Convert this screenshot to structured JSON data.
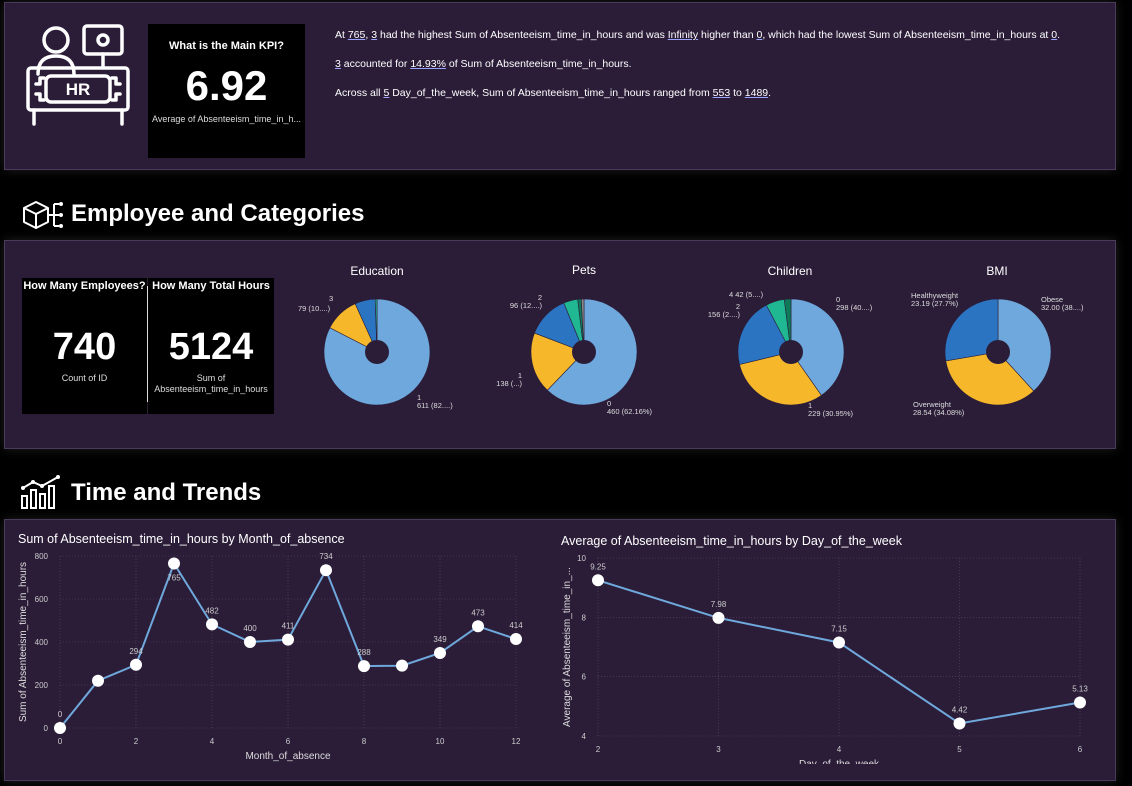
{
  "header": {
    "hr_icon_text": "HR",
    "kpi": {
      "label": "What is the Main KPI?",
      "value": "6.92",
      "sub": "Average of Absenteeism_time_in_h..."
    },
    "narrative": {
      "l1_a": "At ",
      "l1_b": "765",
      "l1_c": ", ",
      "l1_d": "3",
      "l1_e": " had the highest Sum of Absenteeism_time_in_hours and was ",
      "l1_f": "Infinity",
      "l1_g": " higher than ",
      "l1_h": "0",
      "l1_i": ", which had the lowest Sum of Absenteeism_time_in_hours at ",
      "l1_j": "0",
      "l1_k": ".",
      "l2_a": "3",
      "l2_b": " accounted for ",
      "l2_c": "14.93%",
      "l2_d": " of Sum of Absenteeism_time_in_hours.",
      "l3_a": "Across all ",
      "l3_b": "5",
      "l3_c": " Day_of_the_week, Sum of Absenteeism_time_in_hours ranged from ",
      "l3_d": "553",
      "l3_e": " to ",
      "l3_f": "1489",
      "l3_g": "."
    }
  },
  "sections": {
    "employee": "Employee and Categories",
    "time": "Time and Trends"
  },
  "cards": {
    "employees": {
      "label": "How Many Employees?",
      "value": "740",
      "sub": "Count of ID"
    },
    "hours": {
      "label": "How Many Total Hours",
      "value": "5124",
      "sub1": "Sum of",
      "sub2": "Absenteeism_time_in_hours"
    }
  },
  "colors": {
    "light_blue": "#6fa8dc",
    "yellow": "#f6b82a",
    "blue": "#2a74c2",
    "teal": "#1fb892",
    "dark_teal": "#0e7a5a",
    "grey": "#8a8a8a",
    "line": "#6fa8dc"
  },
  "chart_data": [
    {
      "type": "pie",
      "title": "Education",
      "slices": [
        {
          "label": "1",
          "value": 611,
          "text1": "1",
          "text2": "611 (82....)",
          "color": "#6fa8dc"
        },
        {
          "label": "3",
          "value": 79,
          "text1": "3",
          "text2": "79 (10....)",
          "color": "#f6b82a"
        },
        {
          "label": "2",
          "value": 46,
          "text1": "",
          "text2": "",
          "color": "#2a74c2"
        },
        {
          "label": "4",
          "value": 4,
          "text1": "",
          "text2": "",
          "color": "#1fb892"
        }
      ]
    },
    {
      "type": "pie",
      "title": "Pets",
      "slices": [
        {
          "label": "0",
          "value": 460,
          "text1": "0",
          "text2": "460 (62.16%)",
          "color": "#6fa8dc"
        },
        {
          "label": "1",
          "value": 138,
          "text1": "1",
          "text2": "138 (...)",
          "color": "#f6b82a"
        },
        {
          "label": "2",
          "value": 96,
          "text1": "2",
          "text2": "96 (12....)",
          "color": "#2a74c2"
        },
        {
          "label": "4",
          "value": 32,
          "text1": "",
          "text2": "",
          "color": "#1fb892"
        },
        {
          "label": "8",
          "value": 8,
          "text1": "",
          "text2": "",
          "color": "#0e7a5a"
        },
        {
          "label": "5",
          "value": 6,
          "text1": "",
          "text2": "",
          "color": "#8a8a8a"
        }
      ]
    },
    {
      "type": "pie",
      "title": "Children",
      "slices": [
        {
          "label": "0",
          "value": 298,
          "text1": "0",
          "text2": "298 (40....)",
          "color": "#6fa8dc"
        },
        {
          "label": "1",
          "value": 229,
          "text1": "1",
          "text2": "229 (30.95%)",
          "color": "#f6b82a"
        },
        {
          "label": "2",
          "value": 156,
          "text1": "2",
          "text2": "156 (2....)",
          "color": "#2a74c2"
        },
        {
          "label": "4",
          "value": 42,
          "text1": "4 42 (5....)",
          "text2": "",
          "color": "#1fb892"
        },
        {
          "label": "3",
          "value": 15,
          "text1": "",
          "text2": "",
          "color": "#0e7a5a"
        }
      ]
    },
    {
      "type": "pie",
      "title": "BMI",
      "slices": [
        {
          "label": "Obese",
          "value": 32.0,
          "text1": "Obese",
          "text2": "32.00 (38....)",
          "color": "#6fa8dc"
        },
        {
          "label": "Overweight",
          "value": 28.54,
          "text1": "Overweight",
          "text2": "28.54 (34.08%)",
          "color": "#f6b82a"
        },
        {
          "label": "Healthyweight",
          "value": 23.19,
          "text1": "Healthyweight",
          "text2": "23.19 (27.7%)",
          "color": "#2a74c2"
        }
      ]
    },
    {
      "type": "line",
      "title": "Sum of Absenteeism_time_in_hours by Month_of_absence",
      "xlabel": "Month_of_absence",
      "ylabel": "Sum of Absenteeism_time_in_hours",
      "x": [
        0,
        1,
        2,
        3,
        4,
        5,
        6,
        7,
        8,
        9,
        10,
        11,
        12
      ],
      "y": [
        0,
        220,
        294,
        765,
        482,
        400,
        411,
        734,
        288,
        290,
        349,
        473,
        414
      ],
      "labels": [
        "0",
        "",
        "294",
        "765",
        "482",
        "400",
        "411",
        "734",
        "288",
        "",
        "349",
        "473",
        "414"
      ],
      "xlim": [
        0,
        12
      ],
      "ylim": [
        0,
        800
      ],
      "xticks": [
        0,
        2,
        4,
        6,
        8,
        10,
        12
      ],
      "yticks": [
        0,
        200,
        400,
        600,
        800
      ]
    },
    {
      "type": "line",
      "title": "Average of Absenteeism_time_in_hours by Day_of_the_week",
      "xlabel": "Day_of_the_week",
      "ylabel": "Average of Absenteeism_time_in_...",
      "x": [
        2,
        3,
        4,
        5,
        6
      ],
      "y": [
        9.25,
        7.98,
        7.15,
        4.42,
        5.13
      ],
      "labels": [
        "9.25",
        "7.98",
        "7.15",
        "4.42",
        "5.13"
      ],
      "xlim": [
        2,
        6
      ],
      "ylim": [
        4,
        10
      ],
      "xticks": [
        2,
        3,
        4,
        5,
        6
      ],
      "yticks": [
        4,
        6,
        8,
        10
      ]
    }
  ]
}
